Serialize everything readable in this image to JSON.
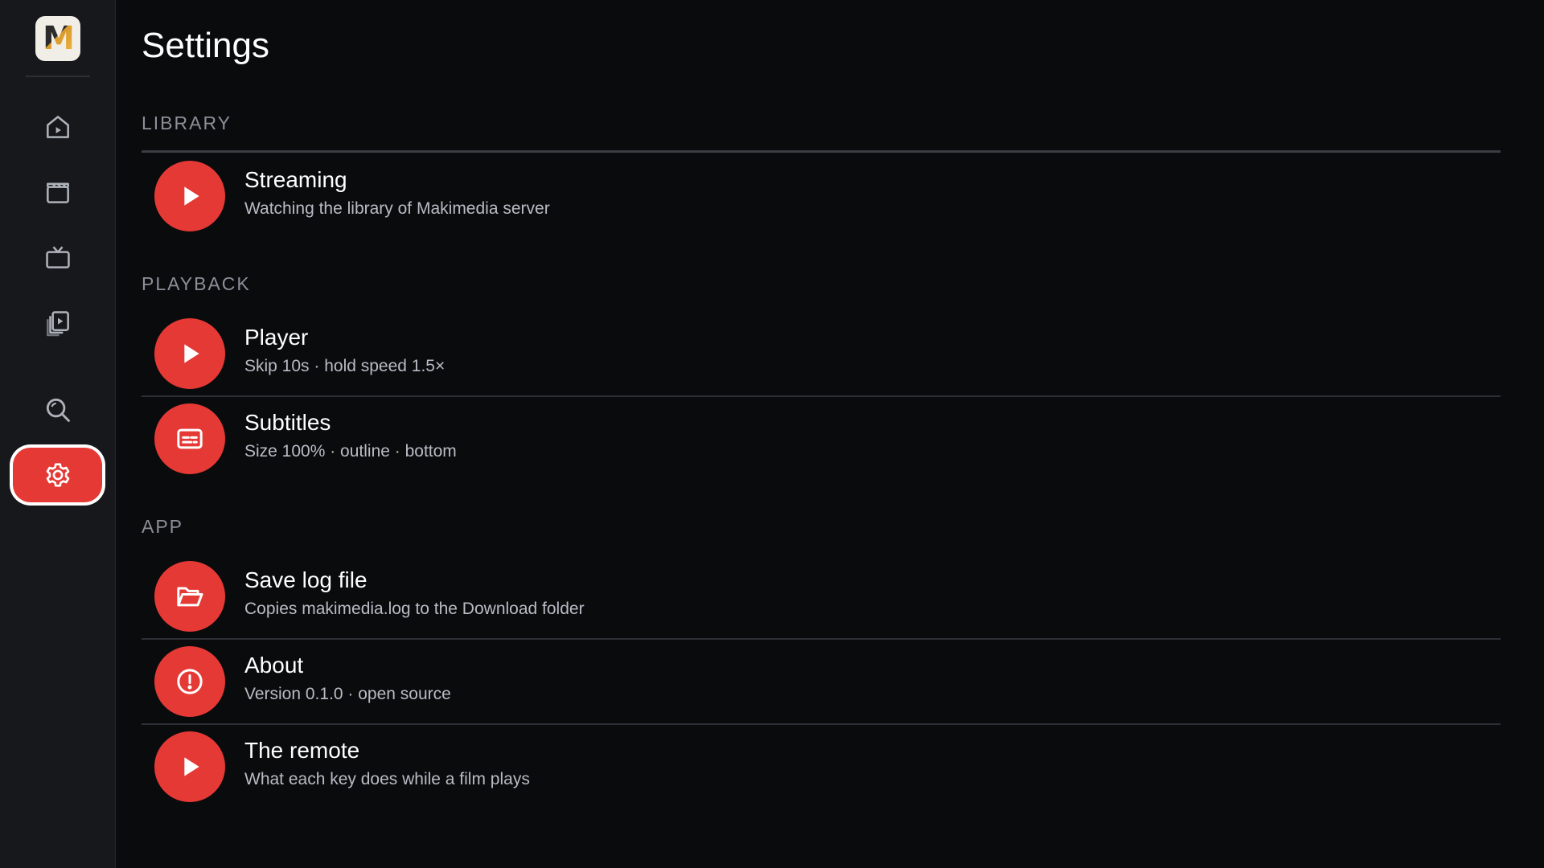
{
  "app": {
    "logo_letter": "M",
    "accent_color": "#e53935"
  },
  "sidebar": {
    "items": [
      {
        "name": "home",
        "icon": "home-icon"
      },
      {
        "name": "movies",
        "icon": "clapperboard-icon"
      },
      {
        "name": "tv",
        "icon": "tv-icon"
      },
      {
        "name": "library",
        "icon": "library-icon"
      },
      {
        "name": "search",
        "icon": "search-icon"
      },
      {
        "name": "settings",
        "icon": "gear-icon",
        "active": true
      }
    ]
  },
  "page": {
    "title": "Settings"
  },
  "sections": {
    "library": {
      "label": "LIBRARY",
      "rows": [
        {
          "title": "Streaming",
          "subtitle": "Watching the library of Makimedia server",
          "icon": "play-icon"
        }
      ]
    },
    "playback": {
      "label": "PLAYBACK",
      "rows": [
        {
          "title": "Player",
          "subtitle": "Skip 10s · hold speed 1.5×",
          "icon": "play-icon"
        },
        {
          "title": "Subtitles",
          "subtitle": "Size 100% · outline · bottom",
          "icon": "subtitles-icon"
        }
      ]
    },
    "app": {
      "label": "APP",
      "rows": [
        {
          "title": "Save log file",
          "subtitle": "Copies makimedia.log to the Download folder",
          "icon": "folder-open-icon"
        },
        {
          "title": "About",
          "subtitle": "Version 0.1.0 · open source",
          "icon": "info-icon"
        },
        {
          "title": "The remote",
          "subtitle": "What each key does while a film plays",
          "icon": "play-icon"
        }
      ]
    }
  }
}
